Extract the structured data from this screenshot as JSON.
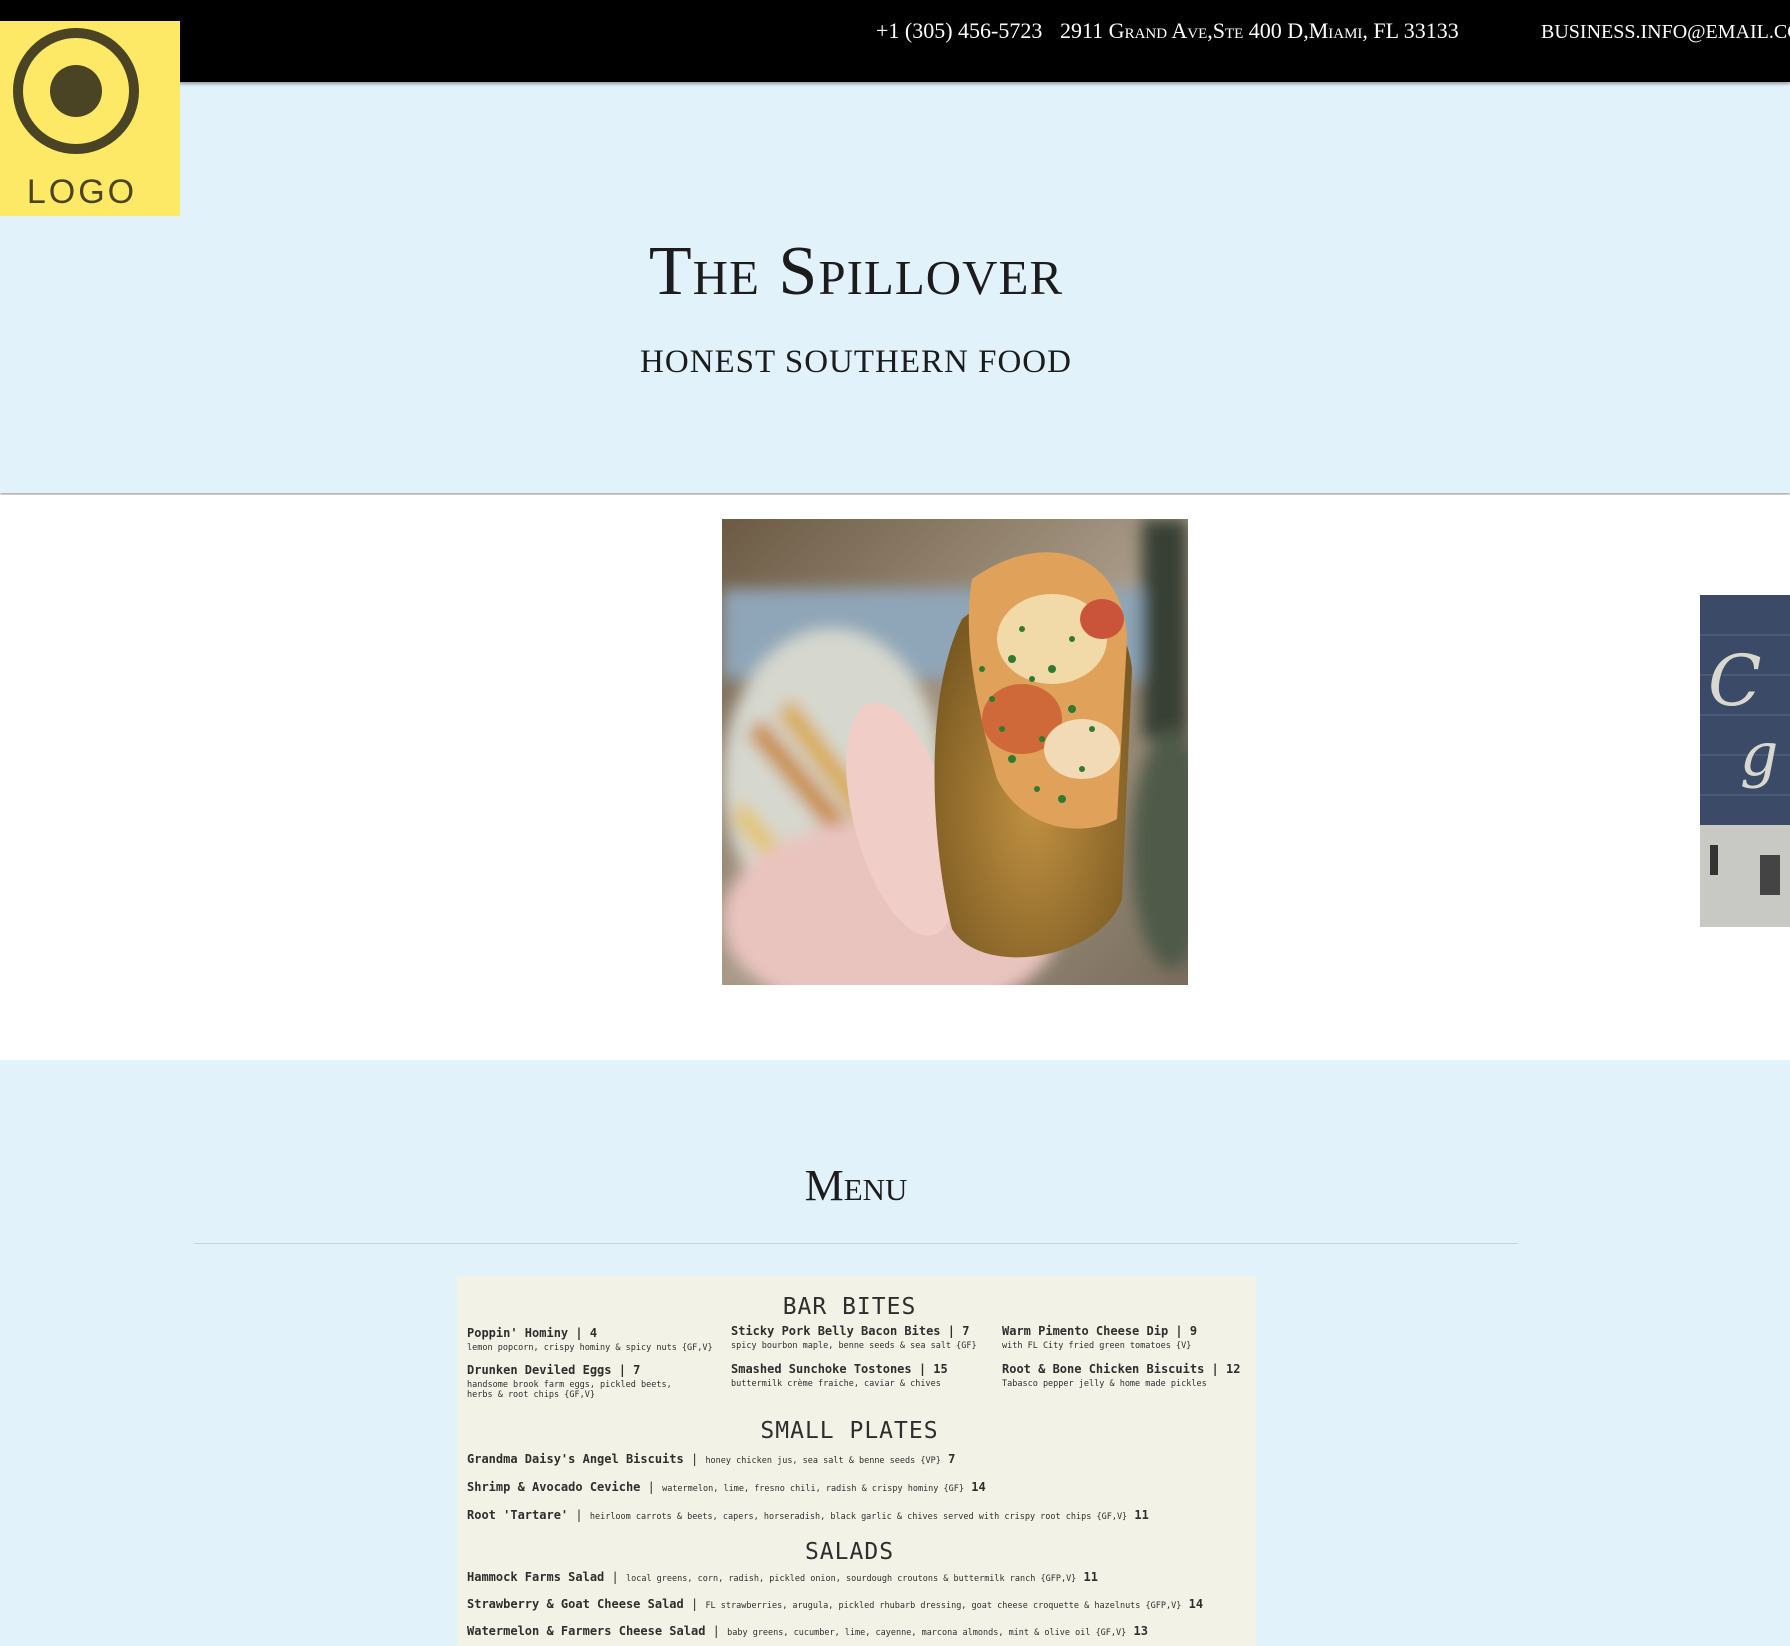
{
  "header": {
    "phone": "+1 (305) 456-5723",
    "address": "2911 Grand Ave,Ste 400 D,Miami, FL 33133",
    "email": "BUSINESS.INFO@EMAIL.COM"
  },
  "logo": {
    "text": "LOGO"
  },
  "hero": {
    "title": "The Spillover",
    "subtitle": "HONEST SOUTHERN FOOD"
  },
  "menu": {
    "heading": "Menu",
    "card": {
      "sections": [
        {
          "title": "BAR BITES",
          "items": [
            {
              "name": "Poppin' Hominy | 4",
              "desc": "lemon popcorn, crispy hominy & spicy nuts {GF,V}"
            },
            {
              "name": "Sticky Pork Belly Bacon Bites | 7",
              "desc": "spicy bourbon maple, benne seeds & sea salt {GF}"
            },
            {
              "name": "Warm Pimento Cheese Dip | 9",
              "desc": "with FL City fried green tomatoes {V}"
            },
            {
              "name": "Drunken Deviled Eggs | 7",
              "desc": "handsome brook farm eggs, pickled beets, herbs & root chips {GF,V}"
            },
            {
              "name": "Smashed Sunchoke Tostones | 15",
              "desc": "buttermilk crème fraiche, caviar & chives"
            },
            {
              "name": "Root & Bone Chicken Biscuits | 12",
              "desc": "Tabasco pepper jelly & home made pickles"
            }
          ]
        },
        {
          "title": "SMALL PLATES",
          "items": [
            {
              "name": "Grandma Daisy's Angel Biscuits",
              "desc": "honey chicken jus, sea salt & benne seeds {VP}",
              "price": "7"
            },
            {
              "name": "Shrimp & Avocado Ceviche",
              "desc": "watermelon, lime, fresno chili, radish & crispy hominy {GF}",
              "price": "14"
            },
            {
              "name": "Root 'Tartare'",
              "desc": "heirloom carrots & beets, capers, horseradish, black garlic & chives served with crispy root chips {GF,V}",
              "price": "11"
            }
          ]
        },
        {
          "title": "SALADS",
          "items": [
            {
              "name": "Hammock Farms Salad",
              "desc": "local greens, corn, radish, pickled onion, sourdough croutons & buttermilk ranch {GFP,V}",
              "price": "11"
            },
            {
              "name": "Strawberry & Goat Cheese Salad",
              "desc": "FL strawberries, arugula, pickled rhubarb dressing, goat cheese croquette & hazelnuts {GFP,V}",
              "price": "14"
            },
            {
              "name": "Watermelon & Farmers Cheese Salad",
              "desc": "baby greens, cucumber, lime, cayenne, marcona almonds, mint & olive oil {GF,V}",
              "price": "13"
            }
          ]
        }
      ]
    }
  }
}
